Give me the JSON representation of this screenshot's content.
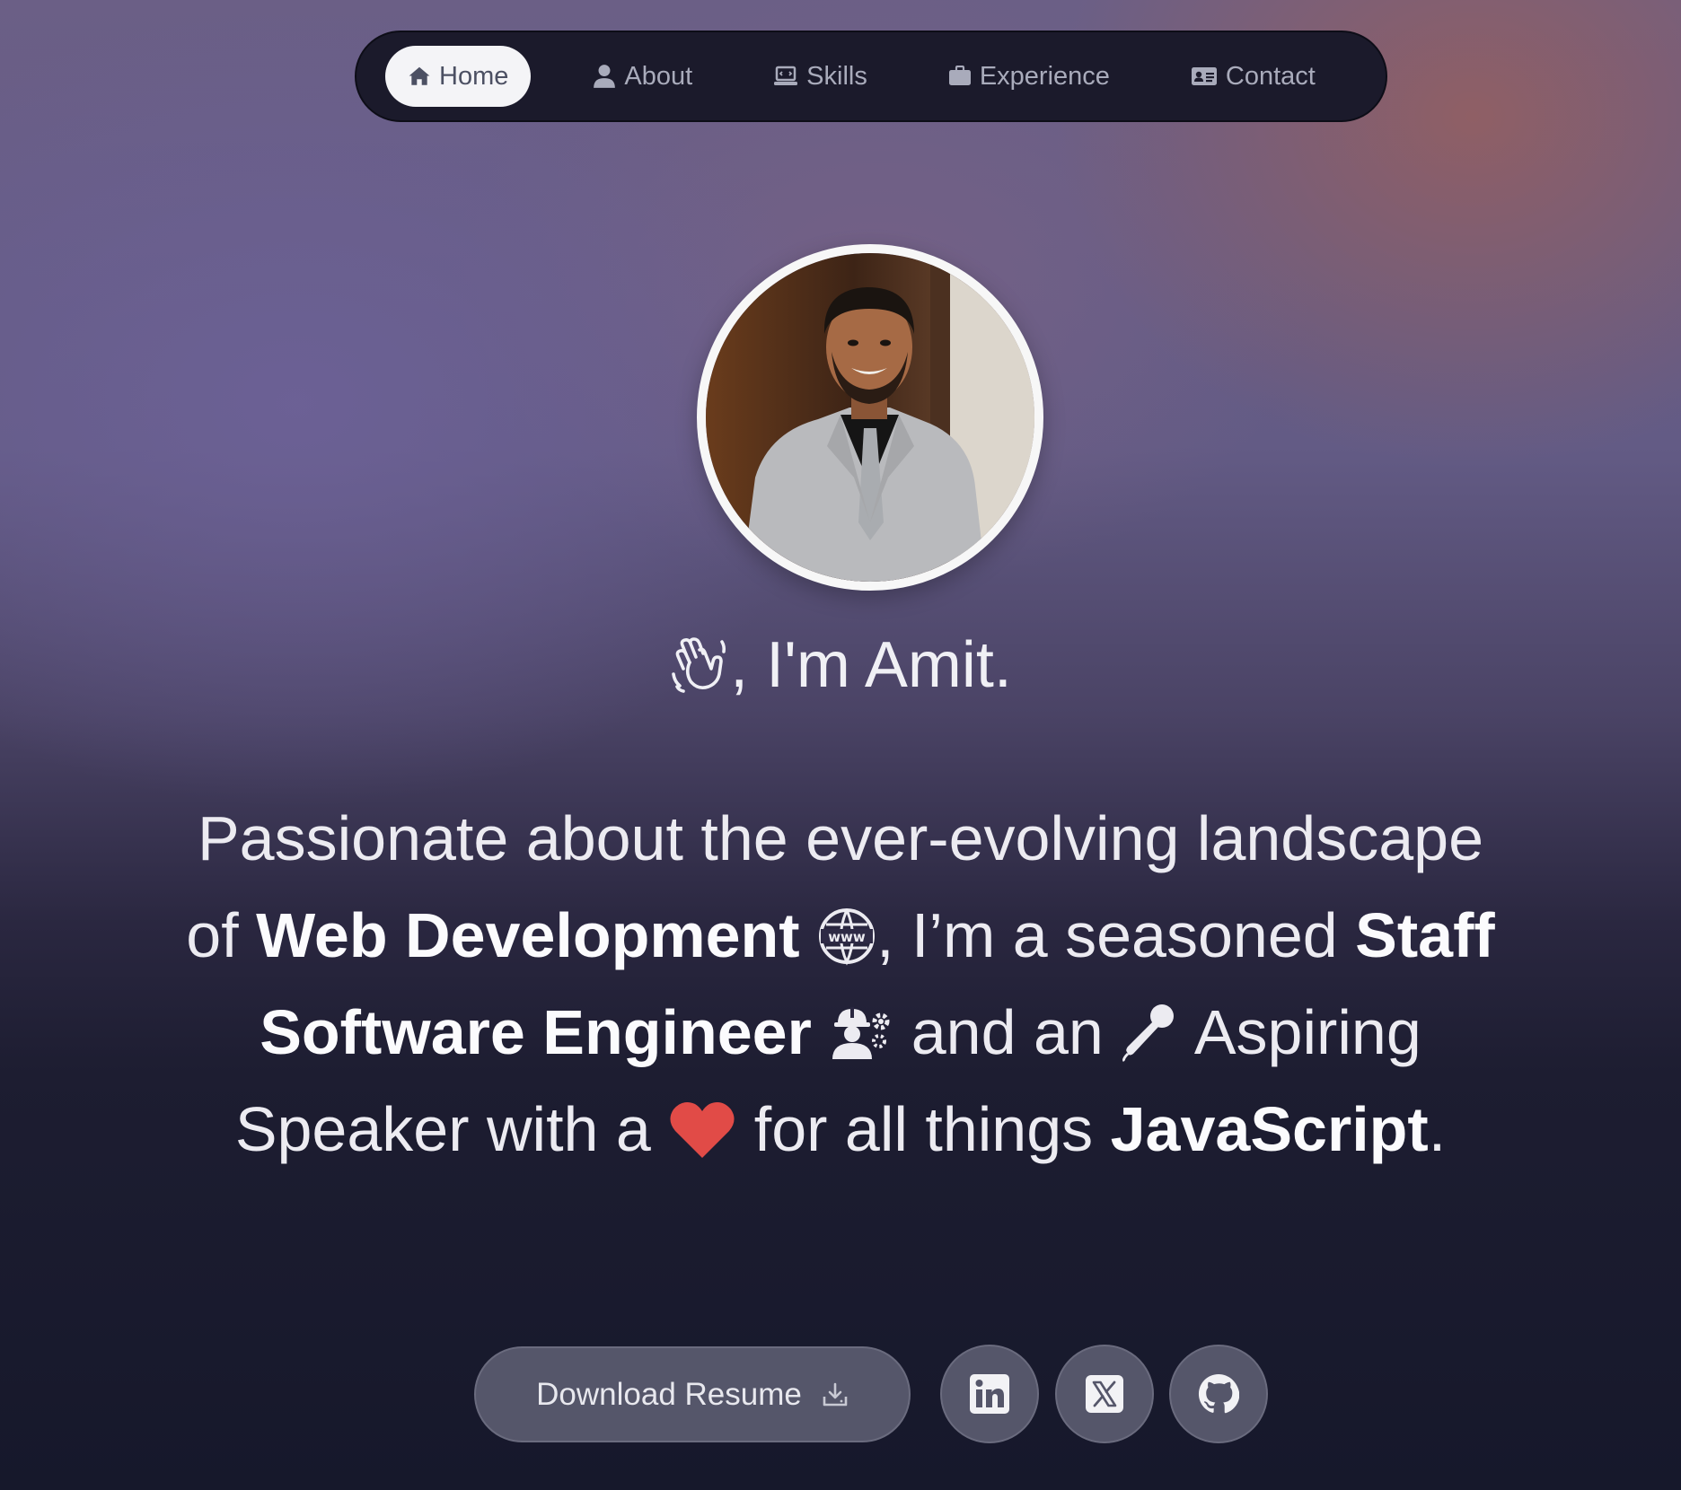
{
  "nav": {
    "items": [
      {
        "label": "Home",
        "icon": "home-icon",
        "active": true
      },
      {
        "label": "About",
        "icon": "user-icon",
        "active": false
      },
      {
        "label": "Skills",
        "icon": "laptop-code-icon",
        "active": false
      },
      {
        "label": "Experience",
        "icon": "briefcase-icon",
        "active": false
      },
      {
        "label": "Contact",
        "icon": "address-card-icon",
        "active": false
      }
    ]
  },
  "profile": {
    "avatar": "profile-photo"
  },
  "hero": {
    "greeting": ", I'm Amit.",
    "greeting_icon": "waving-hand-icon",
    "tagline": {
      "part1": "Passionate about the ever-evolving landscape of ",
      "strong1": "Web Development",
      "icon1": "www-globe-icon",
      "part2": ", I’m a seasoned ",
      "strong2": "Staff Software Engineer",
      "icon2": "engineer-gear-icon",
      "part3": " and an ",
      "icon3": "microphone-icon",
      "part4": " Aspiring Speaker with a ",
      "icon4": "heart-icon",
      "part5": " for all things ",
      "strong3": "JavaScript",
      "part6": "."
    }
  },
  "actions": {
    "resume_label": "Download Resume",
    "resume_icon": "download-icon",
    "social": [
      {
        "name": "linkedin-icon"
      },
      {
        "name": "x-twitter-icon"
      },
      {
        "name": "github-icon"
      }
    ]
  },
  "colors": {
    "heart": "#e14b47",
    "nav_bg": "#1b1a2b",
    "button_bg": "#55566a"
  }
}
